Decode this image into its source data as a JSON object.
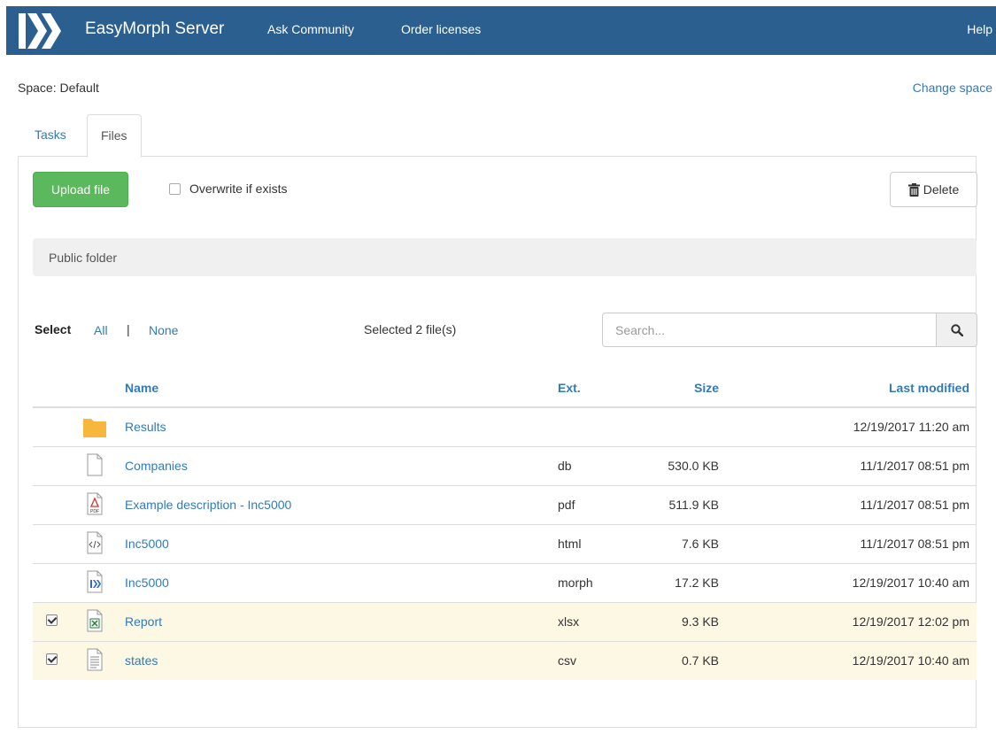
{
  "navbar": {
    "brand": "EasyMorph Server",
    "links": [
      "Ask Community",
      "Order licenses"
    ],
    "help": "Help",
    "bg_color": "#2b5f8f"
  },
  "space": {
    "label": "Space: Default",
    "change_link": "Change space"
  },
  "tabs": [
    {
      "label": "Tasks",
      "active": false
    },
    {
      "label": "Files",
      "active": true
    }
  ],
  "toolbar": {
    "upload_label": "Upload file",
    "overwrite_label": "Overwrite if exists",
    "overwrite_checked": false,
    "delete_label": "Delete",
    "delete_icon": "trash-icon"
  },
  "folder": {
    "name": "Public folder"
  },
  "selection": {
    "label": "Select",
    "all": "All",
    "separator": "|",
    "none": "None",
    "selected_count": "Selected 2 file(s)"
  },
  "search": {
    "placeholder": "Search...",
    "value": "",
    "icon": "search-icon"
  },
  "table": {
    "headers": {
      "name": "Name",
      "ext": "Ext.",
      "size": "Size",
      "modified": "Last modified"
    },
    "rows": [
      {
        "icon": "folder-icon",
        "name": "Results",
        "ext": "",
        "size": "",
        "modified": "12/19/2017 11:20 am",
        "checked": false,
        "checkbox": false
      },
      {
        "icon": "file-icon",
        "name": "Companies",
        "ext": "db",
        "size": "530.0 KB",
        "modified": "11/1/2017 08:51 pm",
        "checked": false,
        "checkbox": false
      },
      {
        "icon": "pdf-file-icon",
        "name": "Example description - Inc5000",
        "ext": "pdf",
        "size": "511.9 KB",
        "modified": "11/1/2017 08:51 pm",
        "checked": false,
        "checkbox": false
      },
      {
        "icon": "html-file-icon",
        "name": "Inc5000",
        "ext": "html",
        "size": "7.6 KB",
        "modified": "11/1/2017 08:51 pm",
        "checked": false,
        "checkbox": false
      },
      {
        "icon": "morph-file-icon",
        "name": "Inc5000",
        "ext": "morph",
        "size": "17.2 KB",
        "modified": "12/19/2017 10:40 am",
        "checked": false,
        "checkbox": false
      },
      {
        "icon": "excel-file-icon",
        "name": "Report",
        "ext": "xlsx",
        "size": "9.3 KB",
        "modified": "12/19/2017 12:02 pm",
        "checked": true,
        "checkbox": true
      },
      {
        "icon": "text-file-icon",
        "name": "states",
        "ext": "csv",
        "size": "0.7 KB",
        "modified": "12/19/2017 10:40 am",
        "checked": true,
        "checkbox": true
      }
    ]
  },
  "colors": {
    "link": "#337ab7",
    "upload_button": "#5cb85c",
    "selected_row": "#fcf8e3",
    "folder": "#f6b73c"
  }
}
